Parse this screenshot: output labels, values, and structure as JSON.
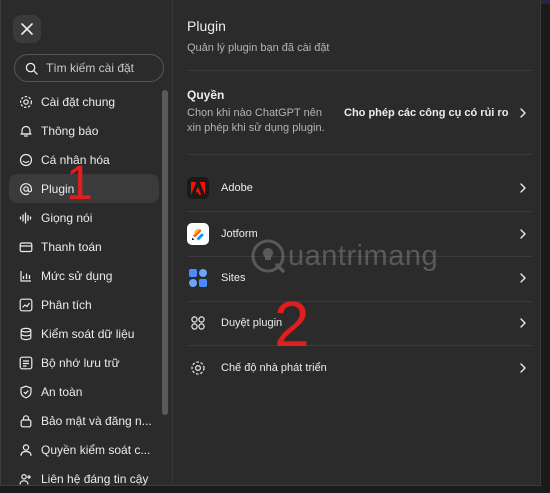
{
  "sidebar": {
    "close_icon": "close-icon",
    "search_placeholder": "Tìm kiếm cài đặt",
    "items": [
      {
        "label": "Cài đặt chung",
        "icon": "gear-icon"
      },
      {
        "label": "Thông báo",
        "icon": "bell-icon"
      },
      {
        "label": "Cá nhân hóa",
        "icon": "personalize-icon"
      },
      {
        "label": "Plugin",
        "icon": "at-icon",
        "active": true
      },
      {
        "label": "Giọng nói",
        "icon": "waveform-icon"
      },
      {
        "label": "Thanh toán",
        "icon": "card-icon"
      },
      {
        "label": "Mức sử dụng",
        "icon": "usage-icon"
      },
      {
        "label": "Phân tích",
        "icon": "chart-icon"
      },
      {
        "label": "Kiểm soát dữ liệu",
        "icon": "database-icon"
      },
      {
        "label": "Bộ nhớ lưu trữ",
        "icon": "memory-icon"
      },
      {
        "label": "An toàn",
        "icon": "shield-icon"
      },
      {
        "label": "Bảo mật và đăng n...",
        "icon": "lock-icon"
      },
      {
        "label": "Quyền kiểm soát c...",
        "icon": "person-icon"
      },
      {
        "label": "Liên hệ đáng tin cậy",
        "icon": "contacts-icon"
      }
    ]
  },
  "main": {
    "title": "Plugin",
    "subtitle": "Quản lý plugin bạn đã cài đặt",
    "permission": {
      "label": "Quyền",
      "description": "Chọn khi nào ChatGPT nên xin phép khi sử dụng plugin.",
      "value": "Cho phép các công cụ có rủi ro ..."
    },
    "plugins": [
      {
        "label": "Adobe",
        "icon": "adobe-logo-icon",
        "color": "#1a1a1a"
      },
      {
        "label": "Jotform",
        "icon": "jotform-logo-icon",
        "color": "#ffffff"
      },
      {
        "label": "Sites",
        "icon": "sites-logo-icon",
        "color": "#2b2b2b"
      },
      {
        "label": "Duyệt plugin",
        "icon": "grid-icon",
        "color": "#2b2b2b"
      },
      {
        "label": "Chế độ nhà phát triển",
        "icon": "gear-icon",
        "color": "#2b2b2b"
      }
    ]
  },
  "annotations": {
    "one": "1",
    "two": "2"
  },
  "watermark": {
    "text": "uantrimang"
  },
  "colors": {
    "annotation": "#e01e1e",
    "active_bg": "#3b3b3b",
    "panel_bg": "#2b2b2b"
  }
}
